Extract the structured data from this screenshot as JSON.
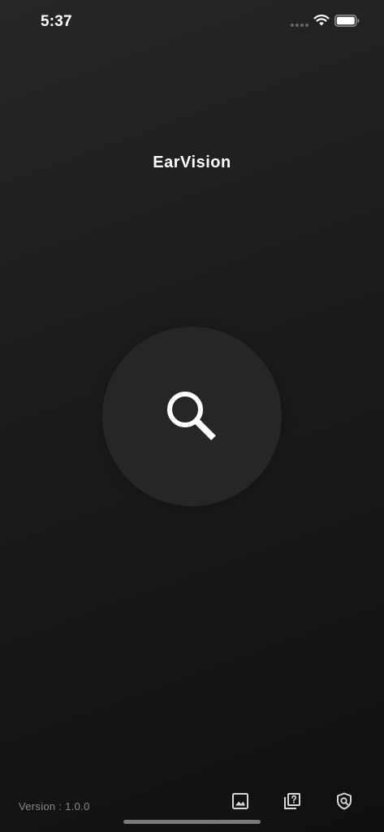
{
  "status_bar": {
    "time": "5:37"
  },
  "app": {
    "title": "EarVision"
  },
  "main": {
    "search_button_icon": "search-icon"
  },
  "footer": {
    "version": "Version : 1.0.0",
    "actions": [
      {
        "icon": "image-gallery-icon"
      },
      {
        "icon": "help-cards-icon"
      },
      {
        "icon": "privacy-shield-icon"
      }
    ]
  },
  "colors": {
    "background_top": "#262626",
    "background_bottom": "#101010",
    "circle": "#262626",
    "text": "#ffffff",
    "muted_text": "#8a8a8a"
  }
}
